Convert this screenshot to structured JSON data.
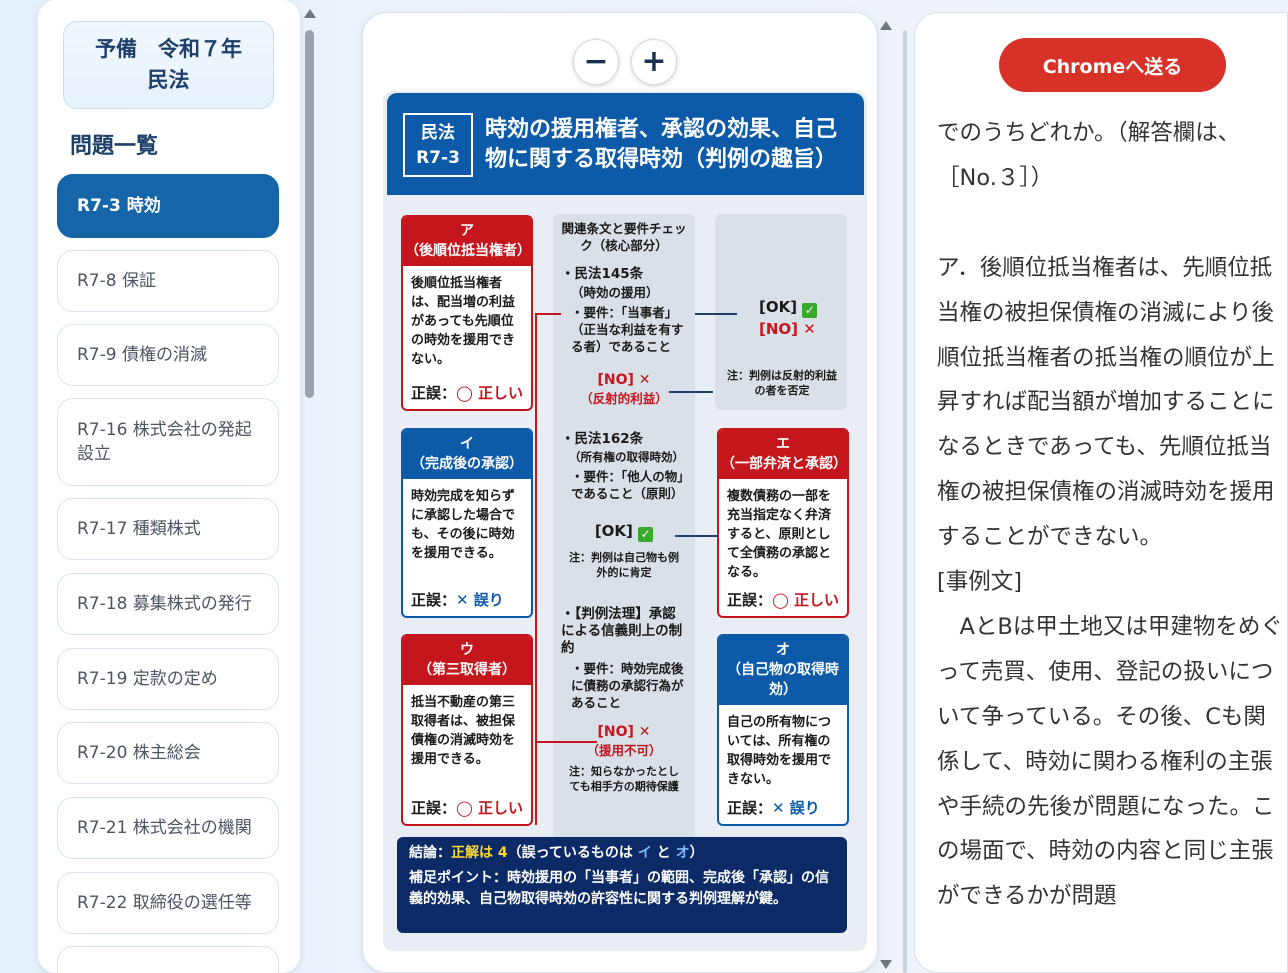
{
  "sidebar": {
    "exam_title_line1": "予備　令和７年",
    "exam_title_line2": "民法",
    "list_heading": "問題一覧",
    "items": [
      {
        "label": "R7-3 時効"
      },
      {
        "label": "R7-8 保証"
      },
      {
        "label": "R7-9 債権の消滅"
      },
      {
        "label": "R7-16 株式会社の発起設立"
      },
      {
        "label": "R7-17 種類株式"
      },
      {
        "label": "R7-18 募集株式の発行"
      },
      {
        "label": "R7-19 定款の定め"
      },
      {
        "label": "R7-20 株主総会"
      },
      {
        "label": "R7-21 株式会社の機関"
      },
      {
        "label": "R7-22 取締役の選任等"
      }
    ]
  },
  "viewer": {
    "zoom_out": "−",
    "zoom_in": "+",
    "infographic": {
      "badge_line1": "民法",
      "badge_line2": "R7-3",
      "title": "時効の援用権者、承認の効果、自己物に関する取得時効（判例の趣旨）",
      "center_heading": "関連条文と要件チェック（核心部分）",
      "center_a_title": "・民法145条",
      "center_a_sub": "（時効の援用）",
      "center_a_req": "・要件：「当事者」（正当な利益を有する者）であること",
      "center_a_no": "[NO] ✕",
      "center_a_no_note": "（反射的利益）",
      "center_b_title": "・民法162条",
      "center_b_sub": "（所有権の取得時効）",
      "center_b_req": "・要件：「他人の物」であること（原則）",
      "center_b_ok": "[OK]",
      "center_b_note": "注：判例は自己物も例外的に肯定",
      "center_c_title": "・【判例法理】承認による信義則上の制約",
      "center_c_req": "・要件：時効完成後に債務の承認行為があること",
      "center_c_no": "[NO] ✕",
      "center_c_no_note": "（援用不可）",
      "center_c_note": "注：知らなかったとしても相手方の期待保護",
      "side_ok": "[OK]",
      "side_no": "[NO] ✕",
      "side_note": "注：判例は反射的利益の者を否定",
      "cards": {
        "a_head1": "ア",
        "a_head2": "（後順位抵当権者）",
        "a_body": "後順位抵当権者は、配当増の利益があっても先順位の時効を援用できない。",
        "a_verdict_prefix": "正誤：",
        "a_verdict": "◯ 正しい",
        "i_head1": "イ",
        "i_head2": "（完成後の承認）",
        "i_body": "時効完成を知らずに承認した場合でも、その後に時効を援用できる。",
        "i_verdict_prefix": "正誤：",
        "i_verdict": "✕ 誤り",
        "u_head1": "ウ",
        "u_head2": "（第三取得者）",
        "u_body": "抵当不動産の第三取得者は、被担保債権の消滅時効を援用できる。",
        "u_verdict_prefix": "正誤：",
        "u_verdict": "◯ 正しい",
        "e_head1": "エ",
        "e_head2": "（一部弁済と承認）",
        "e_body": "複数債務の一部を充当指定なく弁済すると、原則として全債務の承認となる。",
        "e_verdict_prefix": "正誤：",
        "e_verdict": "◯ 正しい",
        "o_head1": "オ",
        "o_head2": "（自己物の取得時効）",
        "o_body": "自己の所有物については、所有権の取得時効を援用できない。",
        "o_verdict_prefix": "正誤：",
        "o_verdict": "✕ 誤り"
      },
      "conclusion_prefix": "結論：",
      "conclusion_answer": "正解は 4",
      "conclusion_mid": "（誤っているものは ",
      "conclusion_i": "イ",
      "conclusion_and": " と ",
      "conclusion_o": "オ",
      "conclusion_end": "）",
      "supplement": "補足ポイント：時効援用の「当事者」の範囲、完成後「承認」の信義的効果、自己物取得時効の許容性に関する判例理解が鍵。"
    }
  },
  "right": {
    "send_button": "Chromeへ送る",
    "paragraphs": [
      "でのうちどれか。（解答欄は、［No.３］）",
      "",
      "ア．後順位抵当権者は、先順位抵当権の被担保債権の消滅により後順位抵当権者の抵当権の順位が上昇すれば配当額が増加することになるときであっても、先順位抵当権の被担保債権の消滅時効を援用することができない。",
      "[事例文]",
      "　AとBは甲土地又は甲建物をめぐって売買、使用、登記の扱いについて争っている。その後、Cも関係して、時効に関わる権利の主張や手続の先後が問題になった。この場面で、時効の内容と同じ主張ができるかが問題"
    ]
  },
  "colors": {
    "accent_blue": "#1565a8",
    "card_red": "#c4161c",
    "card_blue": "#0d5aa8",
    "send_red": "#d83128",
    "navy": "#0b2a66"
  }
}
